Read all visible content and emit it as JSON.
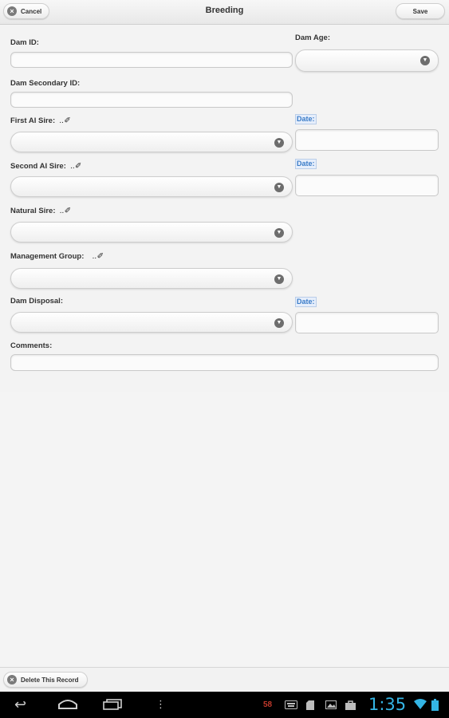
{
  "header": {
    "title": "Breeding",
    "cancel_label": "Cancel",
    "save_label": "Save"
  },
  "form": {
    "dam_id_label": "Dam ID:",
    "dam_age_label": "Dam Age:",
    "dam_secondary_id_label": "Dam Secondary ID:",
    "first_ai_sire_label": "First AI Sire:",
    "second_ai_sire_label": "Second AI Sire:",
    "natural_sire_label": "Natural Sire:",
    "management_group_label": "Management Group:",
    "dam_disposal_label": "Dam Disposal:",
    "comments_label": "Comments:",
    "date_label": "Date:"
  },
  "footer": {
    "delete_label": "Delete This Record"
  },
  "statusbar": {
    "time": "1:35",
    "notification_count": "58"
  },
  "colors": {
    "accent": "#3a7cc8",
    "clock": "#34b5e5"
  },
  "icons": [
    "close-icon",
    "chevron-down-icon",
    "edit-pen-icon",
    "back-icon",
    "home-icon",
    "recent-apps-icon",
    "menu-icon",
    "wifi-icon",
    "battery-icon"
  ]
}
